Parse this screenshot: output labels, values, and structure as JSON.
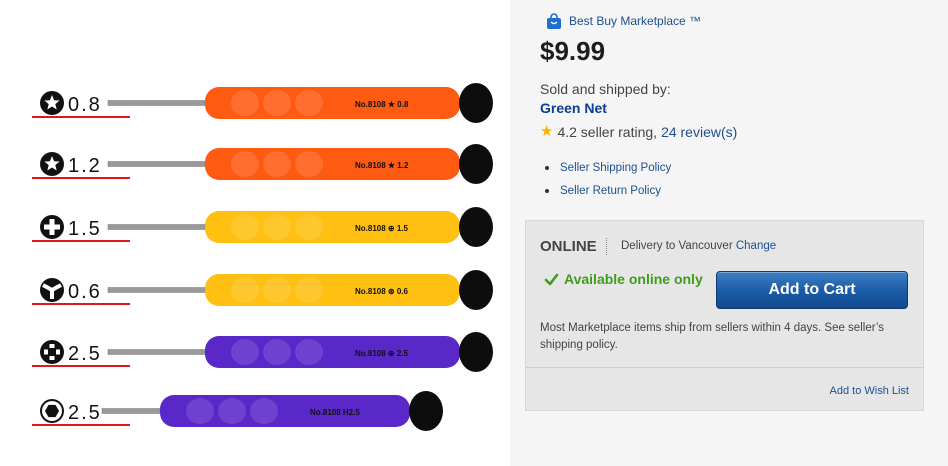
{
  "image": {
    "alt": "Screwdriver set",
    "drivers": [
      {
        "size": "0.8",
        "tip": "star",
        "handle_color": "#ff5a12",
        "band": "No.8108",
        "mark": "★ 0.8"
      },
      {
        "size": "1.2",
        "tip": "star",
        "handle_color": "#ff5a12",
        "band": "No.8108",
        "mark": "★ 1.2"
      },
      {
        "size": "1.5",
        "tip": "phillips",
        "handle_color": "#ffc012",
        "band": "No.8108",
        "mark": "⊕ 1.5"
      },
      {
        "size": "0.6",
        "tip": "tri-wing",
        "handle_color": "#ffc012",
        "band": "No.8108",
        "mark": "⊛ 0.6"
      },
      {
        "size": "2.5",
        "tip": "cross",
        "handle_color": "#5a28c8",
        "band": "No.8108",
        "mark": "⊕ 2.5"
      },
      {
        "size": "2.5",
        "tip": "hex",
        "handle_color": "#5a28c8",
        "band": "No.8108",
        "mark": "H2.5"
      }
    ]
  },
  "marketplace": {
    "label": "Best Buy Marketplace ™",
    "icon": "shopping-bag-icon"
  },
  "price": "$9.99",
  "seller": {
    "sold_by_label": "Sold and shipped by:",
    "name": "Green Net",
    "rating_value": "4.2 seller rating,",
    "reviews_link": "24 review(s)"
  },
  "policies": [
    "Seller Shipping Policy",
    "Seller Return Policy"
  ],
  "buy_box": {
    "channel": "ONLINE",
    "delivery_text": "Delivery to Vancouver",
    "change_link": "Change",
    "availability": "Available online only",
    "add_to_cart": "Add to Cart",
    "ship_note": "Most Marketplace items ship from sellers within 4 days. See seller’s shipping policy.",
    "wishlist": "Add to Wish List"
  },
  "colors": {
    "link": "#1d4f91",
    "available": "#3e9b1b",
    "button": "#1a5aa6",
    "star": "#f5b400"
  }
}
